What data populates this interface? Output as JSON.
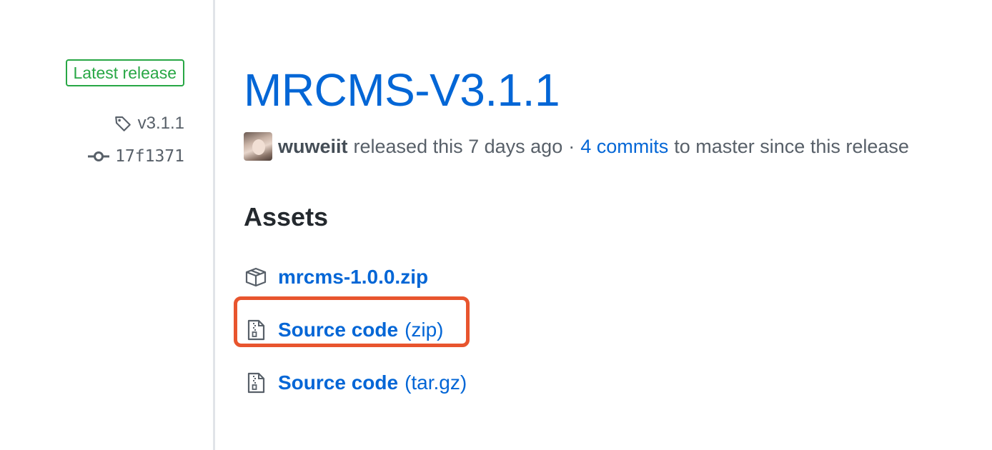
{
  "meta": {
    "latest_badge": "Latest release",
    "tag": "v3.1.1",
    "commit": "17f1371"
  },
  "release": {
    "title": "MRCMS-V3.1.1",
    "author": "wuweiit",
    "released_text": "released this 7 days ago",
    "separator": "·",
    "commits_link": "4 commits",
    "commits_suffix": "to master since this release"
  },
  "assets": {
    "heading": "Assets",
    "items": [
      {
        "name": "mrcms-1.0.0.zip",
        "ext": "",
        "icon": "package-icon"
      },
      {
        "name": "Source code",
        "ext": "(zip)",
        "icon": "file-zip-icon"
      },
      {
        "name": "Source code",
        "ext": "(tar.gz)",
        "icon": "file-zip-icon"
      }
    ]
  },
  "colors": {
    "link": "#0366d6",
    "badge_green": "#28a745",
    "highlight": "#e8552e",
    "muted": "#586069"
  }
}
